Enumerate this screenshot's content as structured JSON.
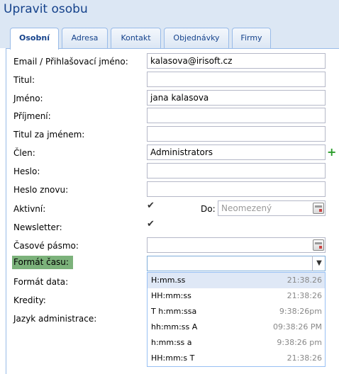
{
  "window": {
    "title": "Upravit osobu"
  },
  "tabs": [
    {
      "label": "Osobní",
      "active": true
    },
    {
      "label": "Adresa",
      "active": false
    },
    {
      "label": "Kontakt",
      "active": false
    },
    {
      "label": "Objednávky",
      "active": false
    },
    {
      "label": "Firmy",
      "active": false
    }
  ],
  "form": {
    "email": {
      "label": "Email / Přihlašovací jméno:",
      "value": "kalasova@irisoft.cz"
    },
    "titul": {
      "label": "Titul:",
      "value": ""
    },
    "jmeno": {
      "label": "Jméno:",
      "value": "jana kalasova"
    },
    "prijmeni": {
      "label": "Příjmení:",
      "value": ""
    },
    "titul_za": {
      "label": "Titul za jménem:",
      "value": ""
    },
    "clen": {
      "label": "Člen:",
      "value": "Administrators",
      "add_icon": "plus-icon"
    },
    "heslo": {
      "label": "Heslo:",
      "value": ""
    },
    "heslo_znovu": {
      "label": "Heslo znovu:",
      "value": ""
    },
    "aktivni": {
      "label": "Aktivní:",
      "checked": true,
      "do_label": "Do:",
      "do_placeholder": "Neomezený"
    },
    "newsletter": {
      "label": "Newsletter:",
      "checked": true
    },
    "casove_pasmo": {
      "label": "Časové pásmo:",
      "value": ""
    },
    "format_casu": {
      "label": "Formát času:",
      "value": ""
    },
    "format_data": {
      "label": "Formát data:"
    },
    "kredity": {
      "label": "Kredity:"
    },
    "jazyk": {
      "label": "Jazyk administrace:"
    }
  },
  "time_format_options": [
    {
      "format": "H:mm.ss",
      "example": "21:38.26",
      "selected": true
    },
    {
      "format": "HH:mm:ss",
      "example": "21:38:26",
      "selected": false
    },
    {
      "format": "T h:mm:ssa",
      "example": "9:38:26pm",
      "selected": false
    },
    {
      "format": "hh:mm:ss A",
      "example": "09:38:26 PM",
      "selected": false
    },
    {
      "format": "h:mm:ss a",
      "example": "9:38:26 pm",
      "selected": false
    },
    {
      "format": "HH:mm:s T",
      "example": "21:38:26",
      "selected": false
    }
  ],
  "colors": {
    "header_bg": "#dce7f4",
    "title": "#15428b",
    "highlight": "#7cb27b",
    "border": "#99bbe8"
  }
}
